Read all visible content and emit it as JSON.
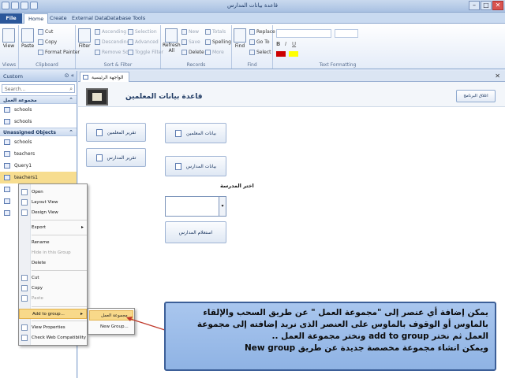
{
  "window": {
    "title": "قاعدة بيانات المدارس"
  },
  "ribbon_tabs": [
    "File",
    "Home",
    "Create",
    "External Data",
    "Database Tools"
  ],
  "ribbon": {
    "views": {
      "label": "Views",
      "view_btn": "View"
    },
    "clipboard": {
      "label": "Clipboard",
      "paste": "Paste",
      "cut": "Cut",
      "copy": "Copy",
      "format_painter": "Format Painter"
    },
    "sort_filter": {
      "label": "Sort & Filter",
      "filter": "Filter",
      "ascending": "Ascending",
      "descending": "Descending",
      "remove_sort": "Remove Sort",
      "selection": "Selection",
      "advanced": "Advanced",
      "toggle_filter": "Toggle Filter"
    },
    "records": {
      "label": "Records",
      "refresh": "Refresh",
      "refresh2": "All",
      "new": "New",
      "save": "Save",
      "delete": "Delete",
      "totals": "Totals",
      "spelling": "Spelling",
      "more": "More"
    },
    "find": {
      "label": "Find",
      "find_btn": "Find",
      "replace": "Replace",
      "go_to": "Go To",
      "select": "Select"
    },
    "text_formatting": {
      "label": "Text Formatting"
    }
  },
  "nav": {
    "header": "Custom",
    "search_placeholder": "Search...",
    "groups": [
      {
        "name": "مجموعة العمل",
        "items": [
          "schools",
          "schools"
        ]
      },
      {
        "name": "Unassigned Objects",
        "items": [
          "schools",
          "teachers",
          "Query1",
          "teachers1",
          "",
          "",
          ""
        ]
      }
    ]
  },
  "doc": {
    "tab": "الواجهة الرئيسية",
    "form_title": "قاعدة بيانات المعلمين",
    "exit_button": "اغلاق البرنامج",
    "buttons": {
      "teachers_report": "تقرير المعلمين",
      "schools_report": "تقرير المدارس",
      "teachers_data": "بيانات المعلمين",
      "schools_data": "بيانات المدارس",
      "school_query": "استعلام المدارس"
    },
    "choose_school_label": "اختر المدرسة"
  },
  "context_menu": [
    {
      "label": "Open",
      "disabled": false
    },
    {
      "label": "Layout View",
      "disabled": false
    },
    {
      "label": "Design View",
      "disabled": false
    },
    {
      "label": "Export",
      "disabled": false
    },
    {
      "label": "Rename",
      "disabled": false
    },
    {
      "label": "Hide in this Group",
      "disabled": true
    },
    {
      "label": "Delete",
      "disabled": false
    },
    {
      "label": "Cut",
      "disabled": false
    },
    {
      "label": "Copy",
      "disabled": false
    },
    {
      "label": "Paste",
      "disabled": true
    },
    {
      "label": "Add to group...",
      "disabled": false
    },
    {
      "label": "View Properties",
      "disabled": false
    },
    {
      "label": "Check Web Compatibility",
      "disabled": false
    }
  ],
  "submenu": [
    "مجموعة العمل",
    "New Group..."
  ],
  "note": {
    "lines": [
      "يمكن إضافة أي عنصر إلى \"مجموعة العمل \" عن طريق السحب والإلقاء",
      "بالماوس أو الوقوف بالماوس على العنصر الذى نريد إضافته إلى مجموعة",
      "العمل ثم نختر add to group ونختر مجموعة العمل ..",
      "ويمكن انشاء مجموعة مخصصة جديدة عن طريق New group"
    ]
  }
}
